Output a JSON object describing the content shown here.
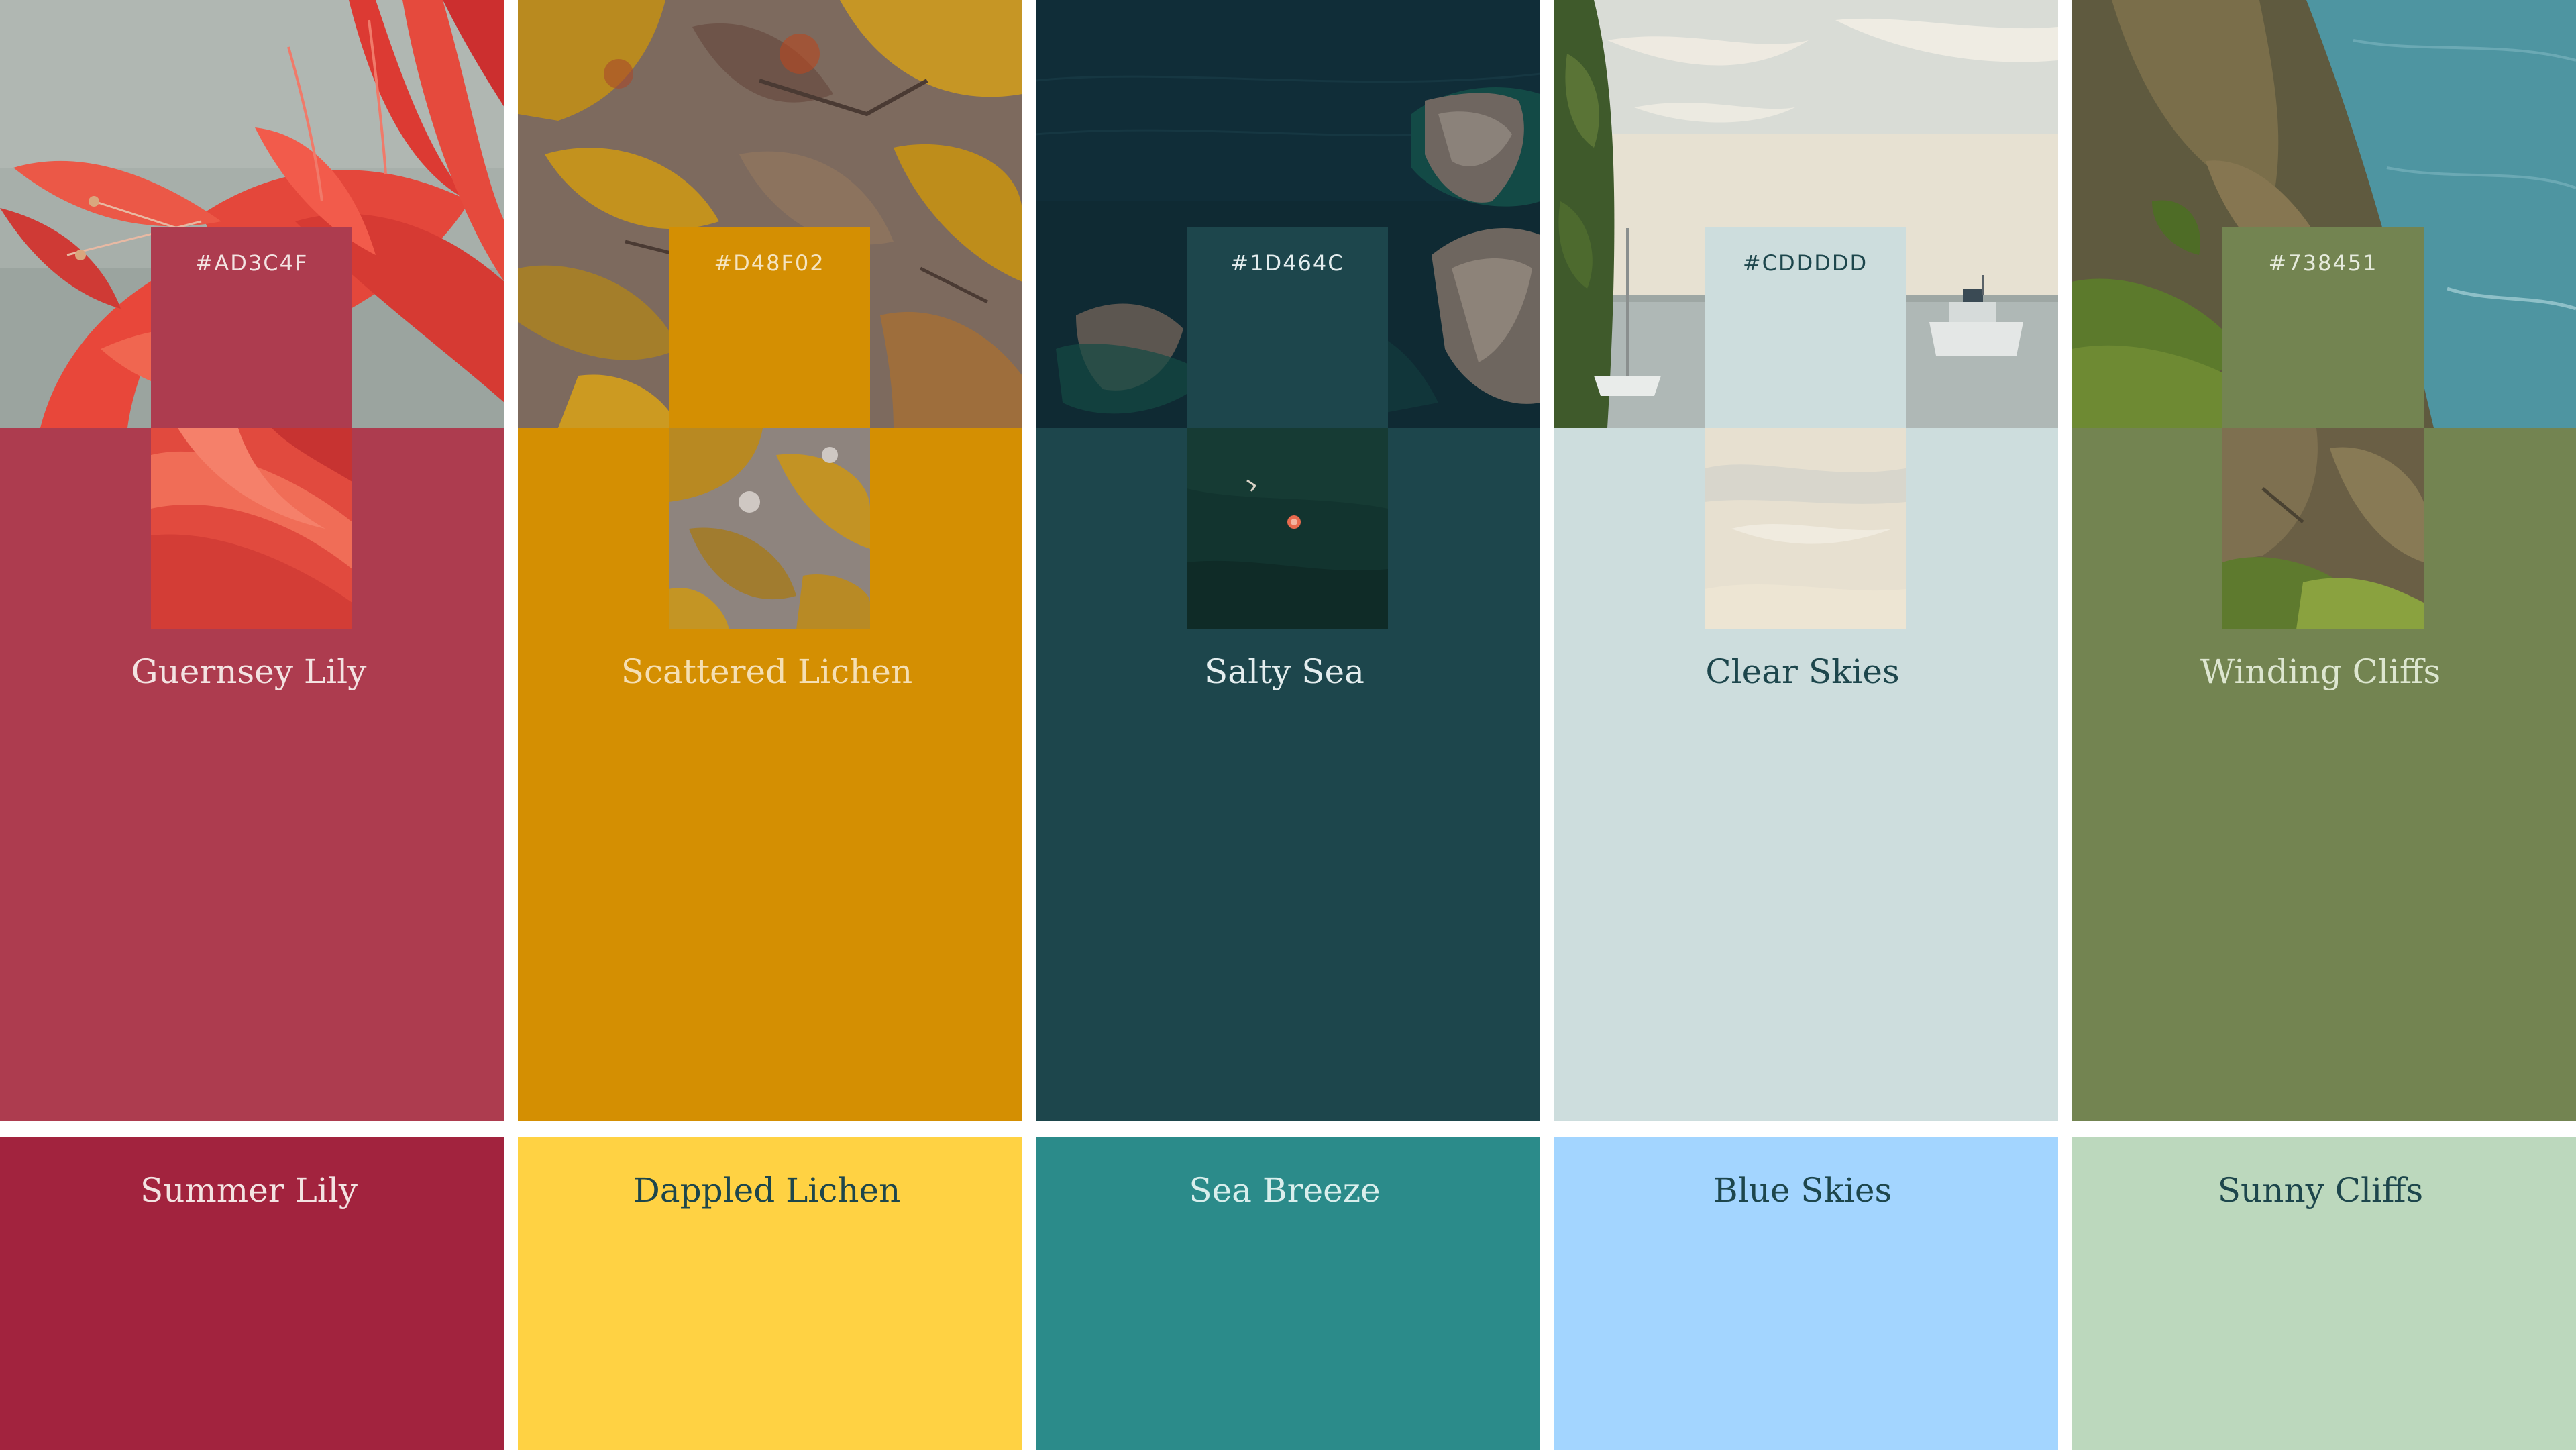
{
  "palettes": [
    {
      "hex_label": "#AD3C4F",
      "name": "Guernsey Lily",
      "color": "#AD3C4F",
      "text_color": "#F3E3E2",
      "hex_text_color": "#F3E3E2",
      "photo": "red-lily-flower",
      "accent": {
        "name": "Summer Lily",
        "color": "#A2233E",
        "text_color": "#F3E3E2"
      }
    },
    {
      "hex_label": "#D48F02",
      "name": "Scattered Lichen",
      "color": "#D48F02",
      "text_color": "#F5DFB3",
      "hex_text_color": "#F5E4C0",
      "photo": "lichen-on-rock",
      "accent": {
        "name": "Dappled Lichen",
        "color": "#FFD243",
        "text_color": "#1D464C"
      }
    },
    {
      "hex_label": "#1D464C",
      "name": "Salty Sea",
      "color": "#1D464C",
      "text_color": "#E4EDEE",
      "hex_text_color": "#E4EDEE",
      "photo": "aerial-sea-and-rocks",
      "accent": {
        "name": "Sea Breeze",
        "color": "#2B8B8A",
        "text_color": "#D9EEEC"
      }
    },
    {
      "hex_label": "#CDDDDD",
      "name": "Clear Skies",
      "color": "#CDDDDD",
      "text_color": "#1D464C",
      "hex_text_color": "#1D464C",
      "photo": "harbour-with-boats",
      "accent": {
        "name": "Blue Skies",
        "color": "#A3D5FF",
        "text_color": "#1D464C"
      }
    },
    {
      "hex_label": "#738451",
      "name": "Winding Cliffs",
      "color": "#738451",
      "text_color": "#DDE6D0",
      "hex_text_color": "#E6EBDD",
      "photo": "coastal-cliffs",
      "accent": {
        "name": "Sunny Cliffs",
        "color": "#BCD8BD",
        "text_color": "#1D464C"
      }
    }
  ]
}
